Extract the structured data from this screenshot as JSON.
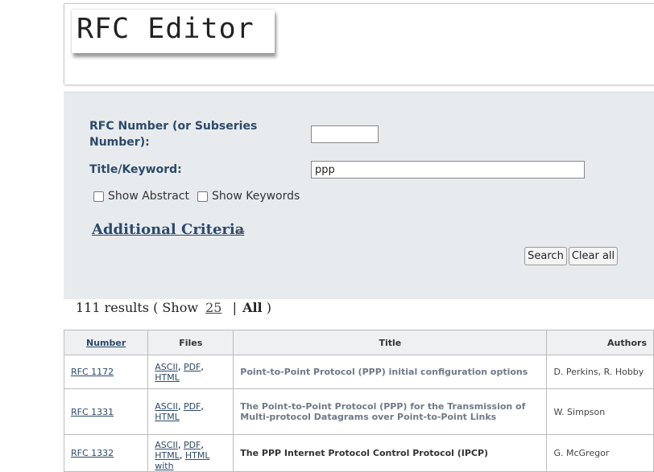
{
  "header": {
    "logo_text": "RFC Editor"
  },
  "form": {
    "rfc_number_label_line1": "RFC Number (or Subseries",
    "rfc_number_label_line2": "Number):",
    "rfc_number_value": "",
    "title_keyword_label": "Title/Keyword:",
    "title_keyword_value": "ppp",
    "show_abstract_label": "Show Abstract",
    "show_keywords_label": "Show Keywords",
    "additional_criteria_label": "Additional Criteria",
    "additional_criteria_icon": "double-chevron-down-icon",
    "search_label": "Search",
    "clear_label": "Clear all"
  },
  "results": {
    "count_text": "111 results ( Show",
    "show_25": "25",
    "separator": "|",
    "show_all": "All",
    "close_paren": ")"
  },
  "table": {
    "headers": [
      "Number",
      "Files",
      "Title",
      "Authors"
    ],
    "rows": [
      {
        "number": "RFC 1172",
        "files": [
          "ASCII",
          "PDF",
          "HTML"
        ],
        "title": "Point-to-Point Protocol (PPP) initial configuration options",
        "authors": "D. Perkins, R. Hobby"
      },
      {
        "number": "RFC 1331",
        "files": [
          "ASCII",
          "PDF",
          "HTML"
        ],
        "title": "The Point-to-Point Protocol (PPP) for the Transmission of Multi-protocol Datagrams over Point-to-Point Links",
        "authors": "W. Simpson"
      },
      {
        "number": "RFC 1332",
        "files": [
          "ASCII",
          "PDF",
          "HTML",
          "HTML with"
        ],
        "title": "The PPP Internet Protocol Control Protocol (IPCP)",
        "authors": "G. McGregor"
      }
    ]
  }
}
